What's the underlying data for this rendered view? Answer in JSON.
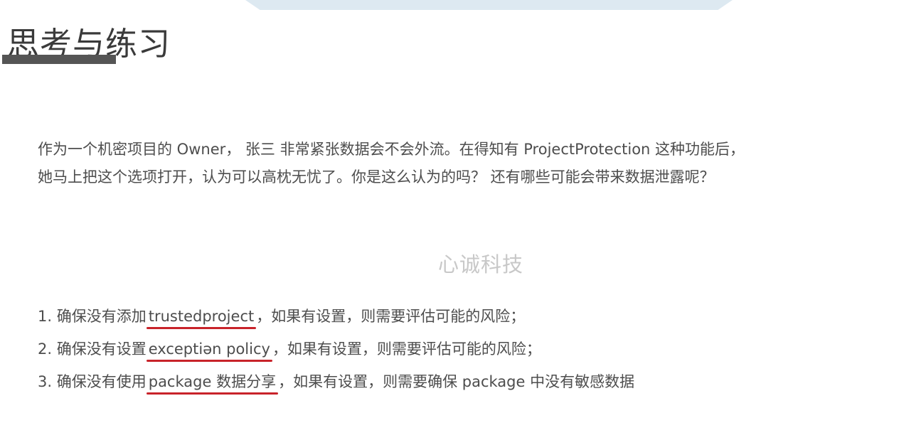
{
  "title": "思考与练习",
  "question": {
    "line1": "作为一个机密项目的 Owner， 张三 非常紧张数据会不会外流。在得知有 ProjectProtection 这种功能后，",
    "line2": "她马上把这个选项打开，认为可以高枕无忧了。你是这么认为的吗？ 还有哪些可能会带来数据泄露呢？"
  },
  "watermark": "心诚科技",
  "answers": [
    {
      "number": "1.",
      "prefix": "确保没有添加",
      "highlight": "trustedproject",
      "suffix": "，如果有设置，则需要评估可能的风险；"
    },
    {
      "number": "2.",
      "prefix": "确保没有设置",
      "highlight": "exceptiən policy",
      "suffix": "，如果有设置，则需要评估可能的风险；"
    },
    {
      "number": "3.",
      "prefix": "确保没有使用",
      "highlight": "package 数据分享",
      "suffix": "，如果有设置，则需要确保 package 中没有敏感数据"
    }
  ],
  "colors": {
    "underline": "#c8232a",
    "title_bar": "#555555",
    "top_tab": "#dde9f1",
    "text": "#4d4d4d",
    "watermark": "#c8c8c8"
  }
}
